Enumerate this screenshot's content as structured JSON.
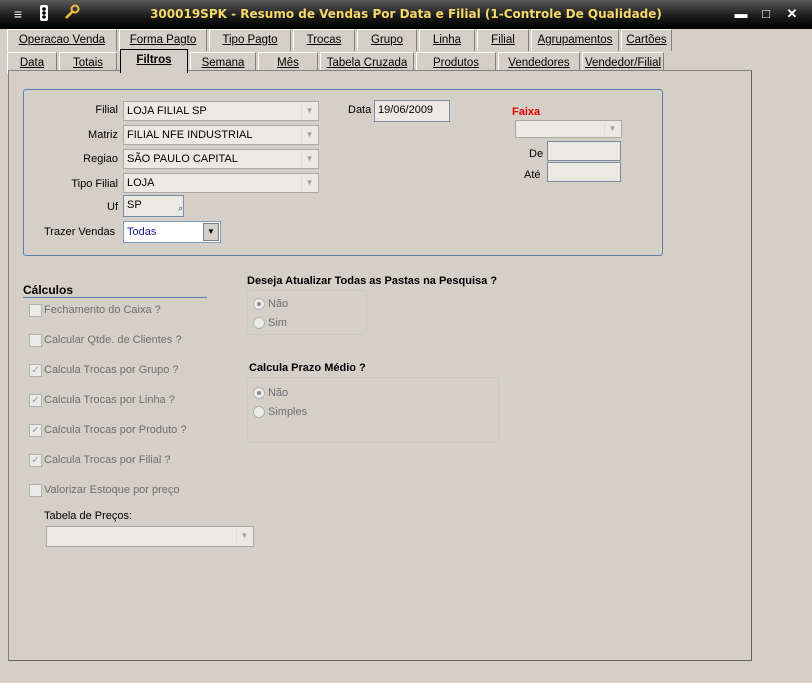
{
  "window": {
    "title": "300019SPK - Resumo de Vendas Por Data e Filial (1-Controle De Qualidade)",
    "minimize": "▬",
    "maximize": "□",
    "close": "✕"
  },
  "tabs_row1": [
    "Operacao Venda",
    "Forma Pagto",
    "Tipo Pagto",
    "Trocas",
    "Grupo",
    "Linha",
    "Filial",
    "Agrupamentos",
    "Cartões"
  ],
  "tabs_row2": [
    "Data",
    "Totais",
    "Filtros",
    "Semana",
    "Mês",
    "Tabela  Cruzada",
    "Produtos",
    "Vendedores",
    "Vendedor/Filial"
  ],
  "active_tab": "Filtros",
  "filters": {
    "filial_label": "Filial",
    "filial_value": "LOJA FILIAL SP",
    "matriz_label": "Matriz",
    "matriz_value": "FILIAL NFE INDUSTRIAL",
    "regiao_label": "Regiao",
    "regiao_value": "SÃO PAULO CAPITAL",
    "tipo_filial_label": "Tipo Filial",
    "tipo_filial_value": "LOJA",
    "uf_label": "Uf",
    "uf_value": "SP",
    "trazer_vendas_label": "Trazer Vendas",
    "trazer_vendas_value": "Todas",
    "data_label": "Data",
    "data_value": "19/06/2009",
    "faixa_label": "Faixa",
    "faixa_color": "#e00000",
    "faixa_value": "",
    "de_label": "De",
    "de_value": "",
    "ate_label": "Até",
    "ate_value": ""
  },
  "calculos": {
    "title": "Cálculos",
    "items": [
      {
        "label": "Fechamento do Caixa ?",
        "checked": false
      },
      {
        "label": "Calcular Qtde. de Clientes ?",
        "checked": false
      },
      {
        "label": "Calcula Trocas por Grupo ?",
        "checked": true
      },
      {
        "label": "Calcula Trocas por Linha ?",
        "checked": true
      },
      {
        "label": "Calcula Trocas por Produto ?",
        "checked": true
      },
      {
        "label": "Calcula Trocas por Filial ?",
        "checked": true
      },
      {
        "label": "Valorizar Estoque por preço",
        "checked": false
      }
    ],
    "tabela_precos_label": "Tabela de Preços:",
    "tabela_precos_value": ""
  },
  "atualizar_pastas": {
    "question": "Deseja Atualizar Todas as Pastas na Pesquisa ?",
    "options": [
      "Não",
      "Sim"
    ],
    "selected": "Não"
  },
  "prazo_medio": {
    "question": "Calcula Prazo Médio ?",
    "options": [
      "Não",
      "Simples"
    ],
    "selected": "Não"
  }
}
